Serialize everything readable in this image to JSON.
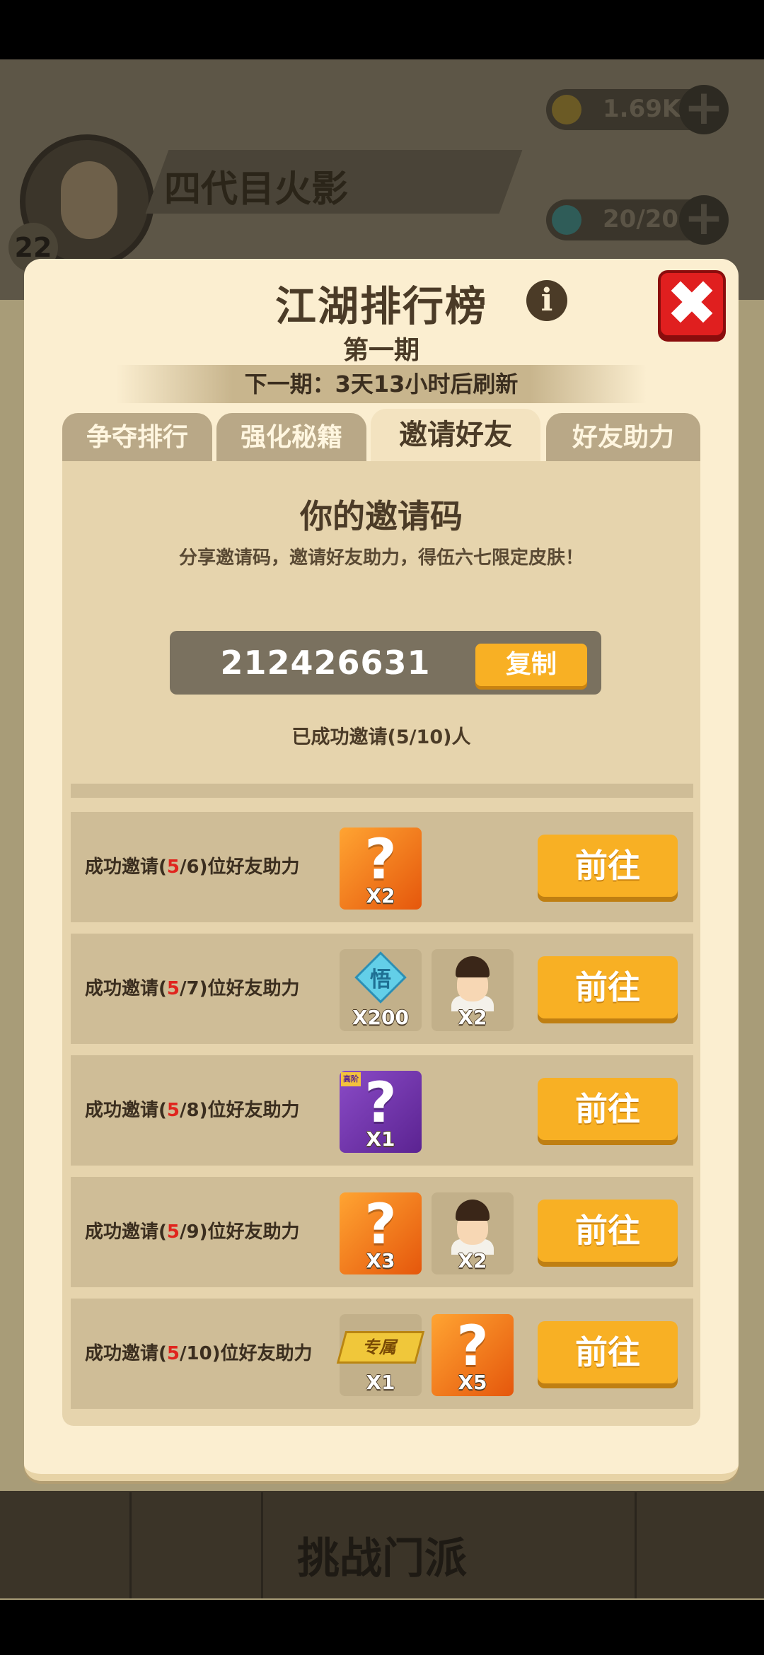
{
  "background": {
    "player_name": "四代目火影",
    "player_level": "22",
    "gold": "1.69K",
    "stamina": "20/20",
    "challenge_label": "挑战门派",
    "plus_symbol": "+"
  },
  "modal": {
    "title": "江湖排行榜",
    "period": "第一期",
    "refresh_text": "下一期：3天13小时后刷新",
    "info_glyph": "i",
    "close_glyph": "✖"
  },
  "tabs": [
    {
      "label": "争夺排行"
    },
    {
      "label": "强化秘籍"
    },
    {
      "label": "邀请好友"
    },
    {
      "label": "好友助力"
    }
  ],
  "invite": {
    "title": "你的邀请码",
    "subtitle": "分享邀请码，邀请好友助力，得伍六七限定皮肤！",
    "code": "212426631",
    "copy_label": "复制",
    "invited_text": "已成功邀请(5/10)人"
  },
  "rewards": [
    {
      "label_prefix": "成功邀请(",
      "current": "5",
      "label_suffix": "/6)位好友助力",
      "go_label": "前往",
      "items": [
        {
          "type": "orange-mystery",
          "glyph": "?",
          "count": "X2"
        }
      ]
    },
    {
      "label_prefix": "成功邀请(",
      "current": "5",
      "label_suffix": "/7)位好友助力",
      "go_label": "前往",
      "items": [
        {
          "type": "gem",
          "glyph": "悟",
          "count": "X200"
        },
        {
          "type": "avatar",
          "count": "X2"
        }
      ]
    },
    {
      "label_prefix": "成功邀请(",
      "current": "5",
      "label_suffix": "/8)位好友助力",
      "go_label": "前往",
      "items": [
        {
          "type": "purple-mystery",
          "glyph": "?",
          "count": "X1",
          "tag": "高阶"
        }
      ]
    },
    {
      "label_prefix": "成功邀请(",
      "current": "5",
      "label_suffix": "/9)位好友助力",
      "go_label": "前往",
      "items": [
        {
          "type": "orange-mystery",
          "glyph": "?",
          "count": "X3"
        },
        {
          "type": "avatar",
          "count": "X2"
        }
      ]
    },
    {
      "label_prefix": "成功邀请(",
      "current": "5",
      "label_suffix": "/10)位好友助力",
      "go_label": "前往",
      "items": [
        {
          "type": "golden-tag",
          "glyph": "专属",
          "count": "X1"
        },
        {
          "type": "orange-mystery",
          "glyph": "?",
          "count": "X5"
        }
      ]
    }
  ],
  "colors": {
    "panel": "#fbeed0",
    "accent_button": "#f8b024",
    "highlight_count": "#e0251e",
    "close_button": "#e01f1f"
  }
}
